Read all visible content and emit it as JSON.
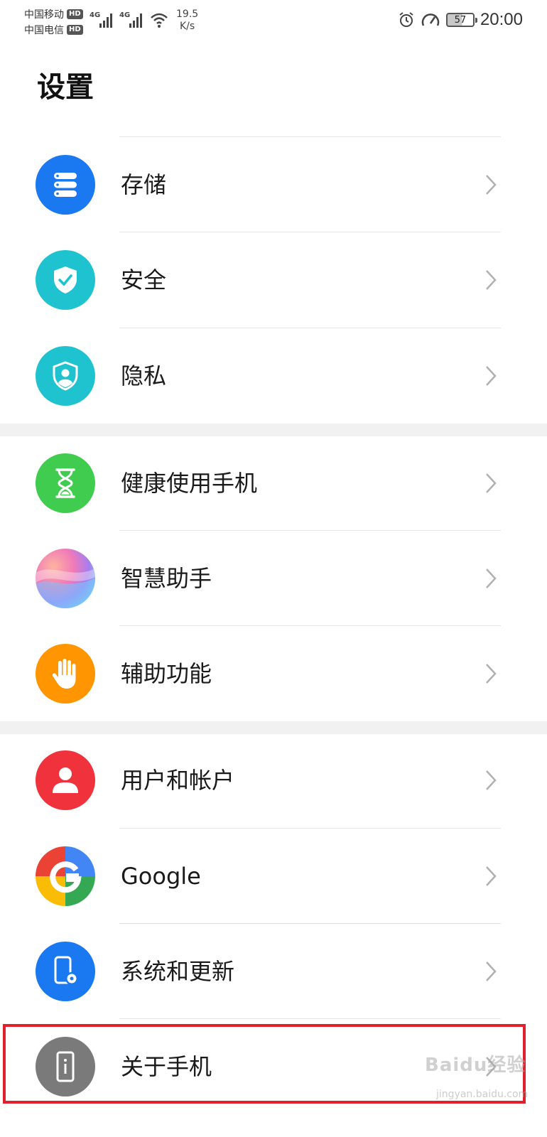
{
  "status_bar": {
    "carrier1": "中国移动",
    "carrier2": "中国电信",
    "hd": "HD",
    "net": "4G",
    "speed_value": "19.5",
    "speed_unit": "K/s",
    "battery": "57",
    "time": "20:00"
  },
  "page": {
    "title": "设置"
  },
  "settings": {
    "storage": "存储",
    "security": "安全",
    "privacy": "隐私",
    "digital_balance": "健康使用手机",
    "assistant": "智慧助手",
    "accessibility": "辅助功能",
    "users_accounts": "用户和帐户",
    "google": "Google",
    "system_update": "系统和更新",
    "about_phone": "关于手机"
  },
  "watermark": {
    "brand": "Baidu经验",
    "url": "jingyan.baidu.com"
  },
  "colors": {
    "storage": "#1a78f0",
    "security": "#1fc3cf",
    "privacy": "#1fc3cf",
    "digital_balance": "#3fcc4f",
    "accessibility": "#ff9500",
    "users_accounts": "#f0323c",
    "system_update": "#1a78f0",
    "about_phone": "#7a7a7a",
    "highlight": "#e0202a"
  }
}
